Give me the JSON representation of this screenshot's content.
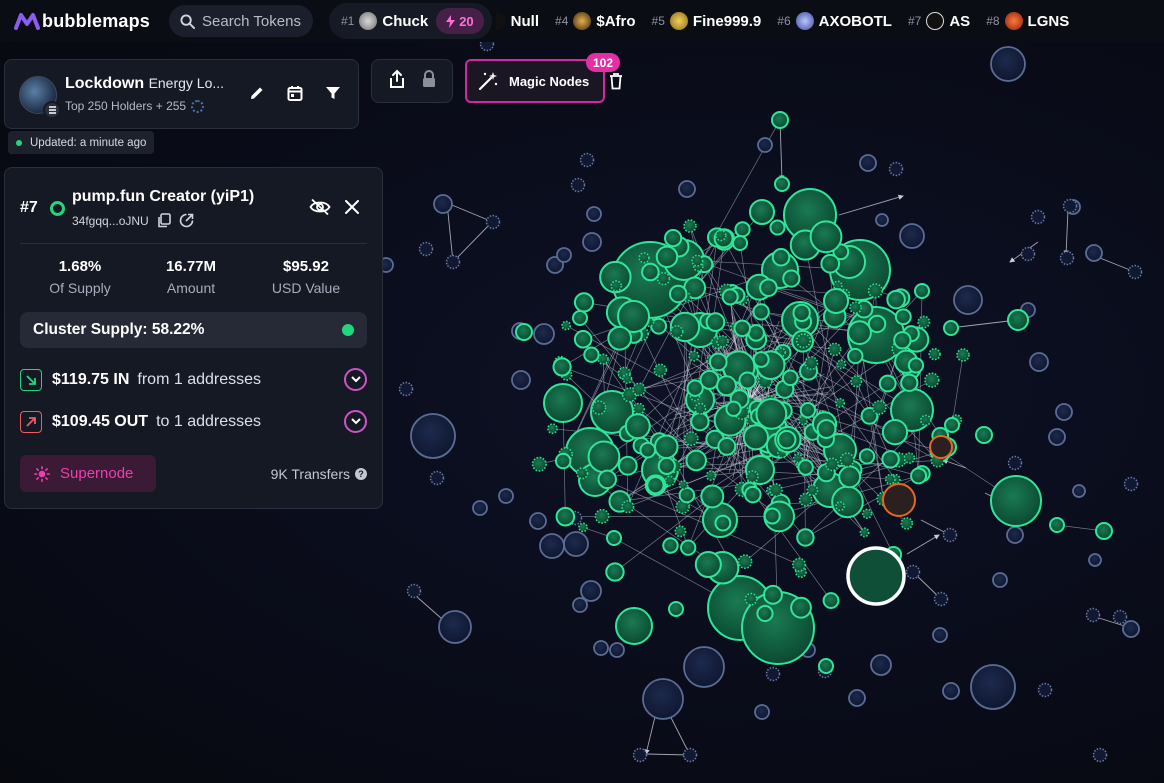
{
  "app": {
    "name": "bubblemaps"
  },
  "search": {
    "placeholder": "Search Tokens"
  },
  "top_tokens": [
    {
      "rank": "#1",
      "name": "Chuck",
      "boost": "20"
    },
    {
      "rank": "",
      "name": "Null"
    },
    {
      "rank": "#4",
      "name": "$Afro"
    },
    {
      "rank": "#5",
      "name": "Fine999.9"
    },
    {
      "rank": "#6",
      "name": "AXOBOTL"
    },
    {
      "rank": "#7",
      "name": "AS"
    },
    {
      "rank": "#8",
      "name": "LGNS"
    }
  ],
  "token_panel": {
    "name_bold": "Lockdown",
    "name_rest": "Energy Lo...",
    "subtitle": "Top 250 Holders + 255",
    "updated": "Updated: a minute ago"
  },
  "magic_nodes": {
    "label": "Magic Nodes",
    "count": "102"
  },
  "detail": {
    "rank": "#7",
    "name": "pump.fun Creator (yiP1)",
    "address": "34fgqq...oJNU",
    "stats": [
      {
        "value": "1.68%",
        "label": "Of Supply"
      },
      {
        "value": "16.77M",
        "label": "Amount"
      },
      {
        "value": "$95.92",
        "label": "USD Value"
      }
    ],
    "cluster_supply": "Cluster Supply: 58.22%",
    "in_amount": "$119.75 IN",
    "in_rest": "from 1 addresses",
    "out_amount": "$109.45 OUT",
    "out_rest": "to 1 addresses",
    "supernode_label": "Supernode",
    "transfers": "9K Transfers"
  },
  "colors": {
    "accent_green": "#21d67d",
    "accent_pink": "#e32ea6",
    "node_green_fill": "#0f5a3d",
    "node_blue": "#5b6c94",
    "highlight_orange": "#e8661f",
    "panel_bg": "#151924"
  }
}
